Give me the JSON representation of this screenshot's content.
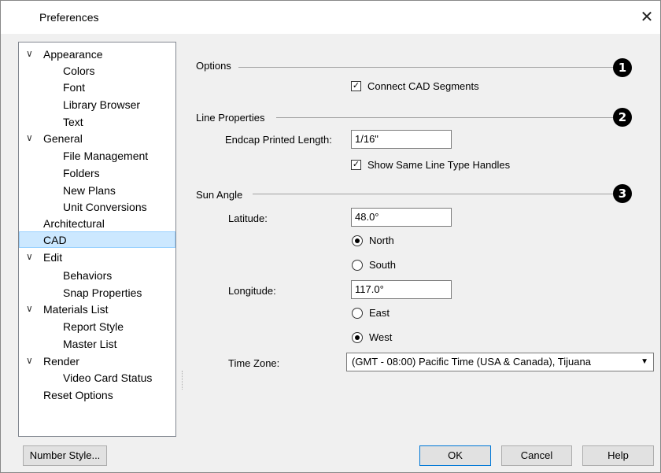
{
  "window": {
    "title": "Preferences",
    "close_glyph": "✕"
  },
  "tree": {
    "items": [
      {
        "label": "Appearance",
        "expanded": true
      },
      {
        "label": "Colors"
      },
      {
        "label": "Font"
      },
      {
        "label": "Library Browser"
      },
      {
        "label": "Text"
      },
      {
        "label": "General",
        "expanded": true
      },
      {
        "label": "File Management"
      },
      {
        "label": "Folders"
      },
      {
        "label": "New Plans"
      },
      {
        "label": "Unit Conversions"
      },
      {
        "label": "Architectural"
      },
      {
        "label": "CAD",
        "selected": true
      },
      {
        "label": "Edit",
        "expanded": true
      },
      {
        "label": "Behaviors"
      },
      {
        "label": "Snap Properties"
      },
      {
        "label": "Materials List",
        "expanded": true
      },
      {
        "label": "Report Style"
      },
      {
        "label": "Master List"
      },
      {
        "label": "Render",
        "expanded": true
      },
      {
        "label": "Video Card Status"
      },
      {
        "label": "Reset Options"
      }
    ]
  },
  "options": {
    "heading": "Options",
    "badge": "1",
    "connect_cad_segments": {
      "label": "Connect CAD Segments",
      "checked": true
    }
  },
  "line_properties": {
    "heading": "Line Properties",
    "badge": "2",
    "endcap_label": "Endcap Printed Length:",
    "endcap_value": "1/16\"",
    "show_same_line_type_handles": {
      "label": "Show Same Line Type Handles",
      "checked": true
    }
  },
  "sun_angle": {
    "heading": "Sun Angle",
    "badge": "3",
    "latitude_label": "Latitude:",
    "latitude_value": "48.0°",
    "north_label": "North",
    "south_label": "South",
    "latitude_selected": "North",
    "longitude_label": "Longitude:",
    "longitude_value": "117.0°",
    "east_label": "East",
    "west_label": "West",
    "longitude_selected": "West",
    "time_zone_label": "Time Zone:",
    "time_zone_value": "(GMT - 08:00) Pacific Time (USA & Canada), Tijuana"
  },
  "buttons": {
    "number_style": "Number Style...",
    "ok": "OK",
    "cancel": "Cancel",
    "help": "Help"
  },
  "colors": {
    "selection": "#cce8ff",
    "default_button_border": "#0078d7"
  }
}
